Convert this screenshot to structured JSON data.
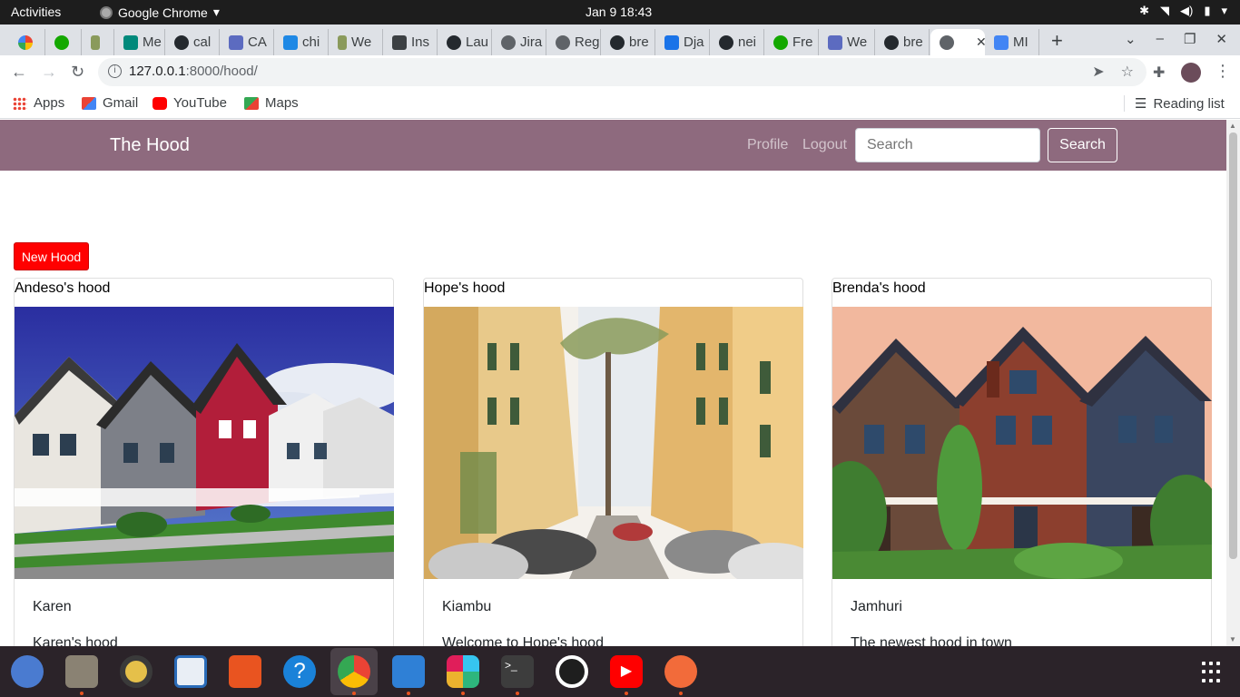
{
  "system": {
    "activities": "Activities",
    "app_name": "Google Chrome",
    "clock": "Jan 9  18:43"
  },
  "tabs": [
    {
      "label": "",
      "icon": "google-icon"
    },
    {
      "label": "",
      "icon": "upwork-icon"
    },
    {
      "label": "",
      "icon": "palm-icon"
    },
    {
      "label": "Me",
      "icon": "meet-icon"
    },
    {
      "label": "cal",
      "icon": "github-icon"
    },
    {
      "label": "CA",
      "icon": "docs-icon"
    },
    {
      "label": "chi",
      "icon": "jira-icon"
    },
    {
      "label": "We",
      "icon": "palm-icon"
    },
    {
      "label": "Ins",
      "icon": "page-icon"
    },
    {
      "label": "Lau",
      "icon": "github-icon"
    },
    {
      "label": "Jira",
      "icon": "globe-icon"
    },
    {
      "label": "Reg",
      "icon": "globe-icon"
    },
    {
      "label": "bre",
      "icon": "github-icon"
    },
    {
      "label": "Dja",
      "icon": "chat-icon"
    },
    {
      "label": "nei",
      "icon": "github-icon"
    },
    {
      "label": "Fre",
      "icon": "upwork-icon"
    },
    {
      "label": "We",
      "icon": "docs-icon"
    },
    {
      "label": "bre",
      "icon": "github-icon"
    },
    {
      "label": "",
      "icon": "globe-icon",
      "active": true
    },
    {
      "label": "MI",
      "icon": "code-icon"
    }
  ],
  "address_bar": {
    "host": "127.0.0.1",
    "path": ":8000/hood/"
  },
  "bookmarks": [
    {
      "label": "Apps",
      "icon": "apps-grid-icon"
    },
    {
      "label": "Gmail",
      "icon": "gmail-icon"
    },
    {
      "label": "YouTube",
      "icon": "youtube-icon"
    },
    {
      "label": "Maps",
      "icon": "maps-icon"
    }
  ],
  "reading_list": "Reading list",
  "site": {
    "brand": "The Hood",
    "nav": {
      "profile": "Profile",
      "logout": "Logout"
    },
    "search_placeholder": "Search",
    "search_button": "Search",
    "new_hood_button": "New Hood"
  },
  "hoods": [
    {
      "name": "Andeso's hood",
      "location": "Karen",
      "description": "Karen's hood",
      "image": "suburban-houses-photo"
    },
    {
      "name": "Hope's hood",
      "location": "Kiambu",
      "description": "Welcome to Hope's hood",
      "image": "street-apartments-photo"
    },
    {
      "name": "Brenda's hood",
      "location": "Jamhuri",
      "description": "The newest hood in town",
      "image": "victorian-houses-photo"
    }
  ],
  "colors": {
    "navbar": "#8e6a7e",
    "new_hood": "#ff0000"
  }
}
